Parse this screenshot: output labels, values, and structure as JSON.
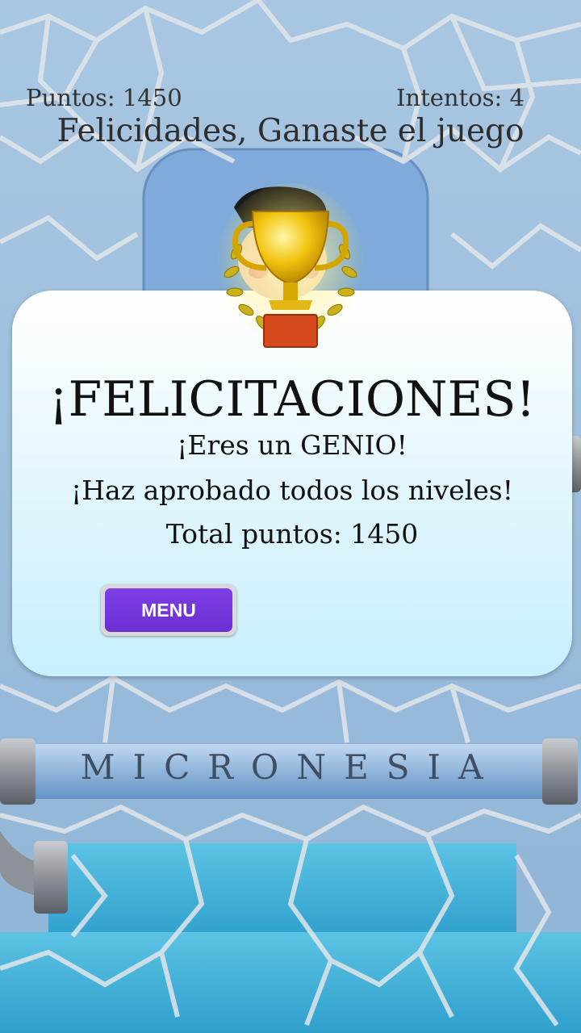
{
  "hud": {
    "score_text": "Puntos: 1450",
    "attempts_text": "Intentos: 4",
    "status_text": "Felicidades, Ganaste el juego"
  },
  "board": {
    "word": "MICRONESIA"
  },
  "dialog": {
    "title": "¡FELICITACIONES!",
    "line1": "¡Eres un GENIO!",
    "line2": "¡Haz aprobado todos los niveles!",
    "line3": "Total puntos: 1450",
    "menu_label": "MENU"
  },
  "icons": {
    "trophy": "trophy-icon",
    "character": "character-icon"
  },
  "colors": {
    "button": "#6a2fd3",
    "dialog_top": "#ffffff",
    "dialog_bottom": "#c7effd",
    "water": "#4fb3d6"
  }
}
